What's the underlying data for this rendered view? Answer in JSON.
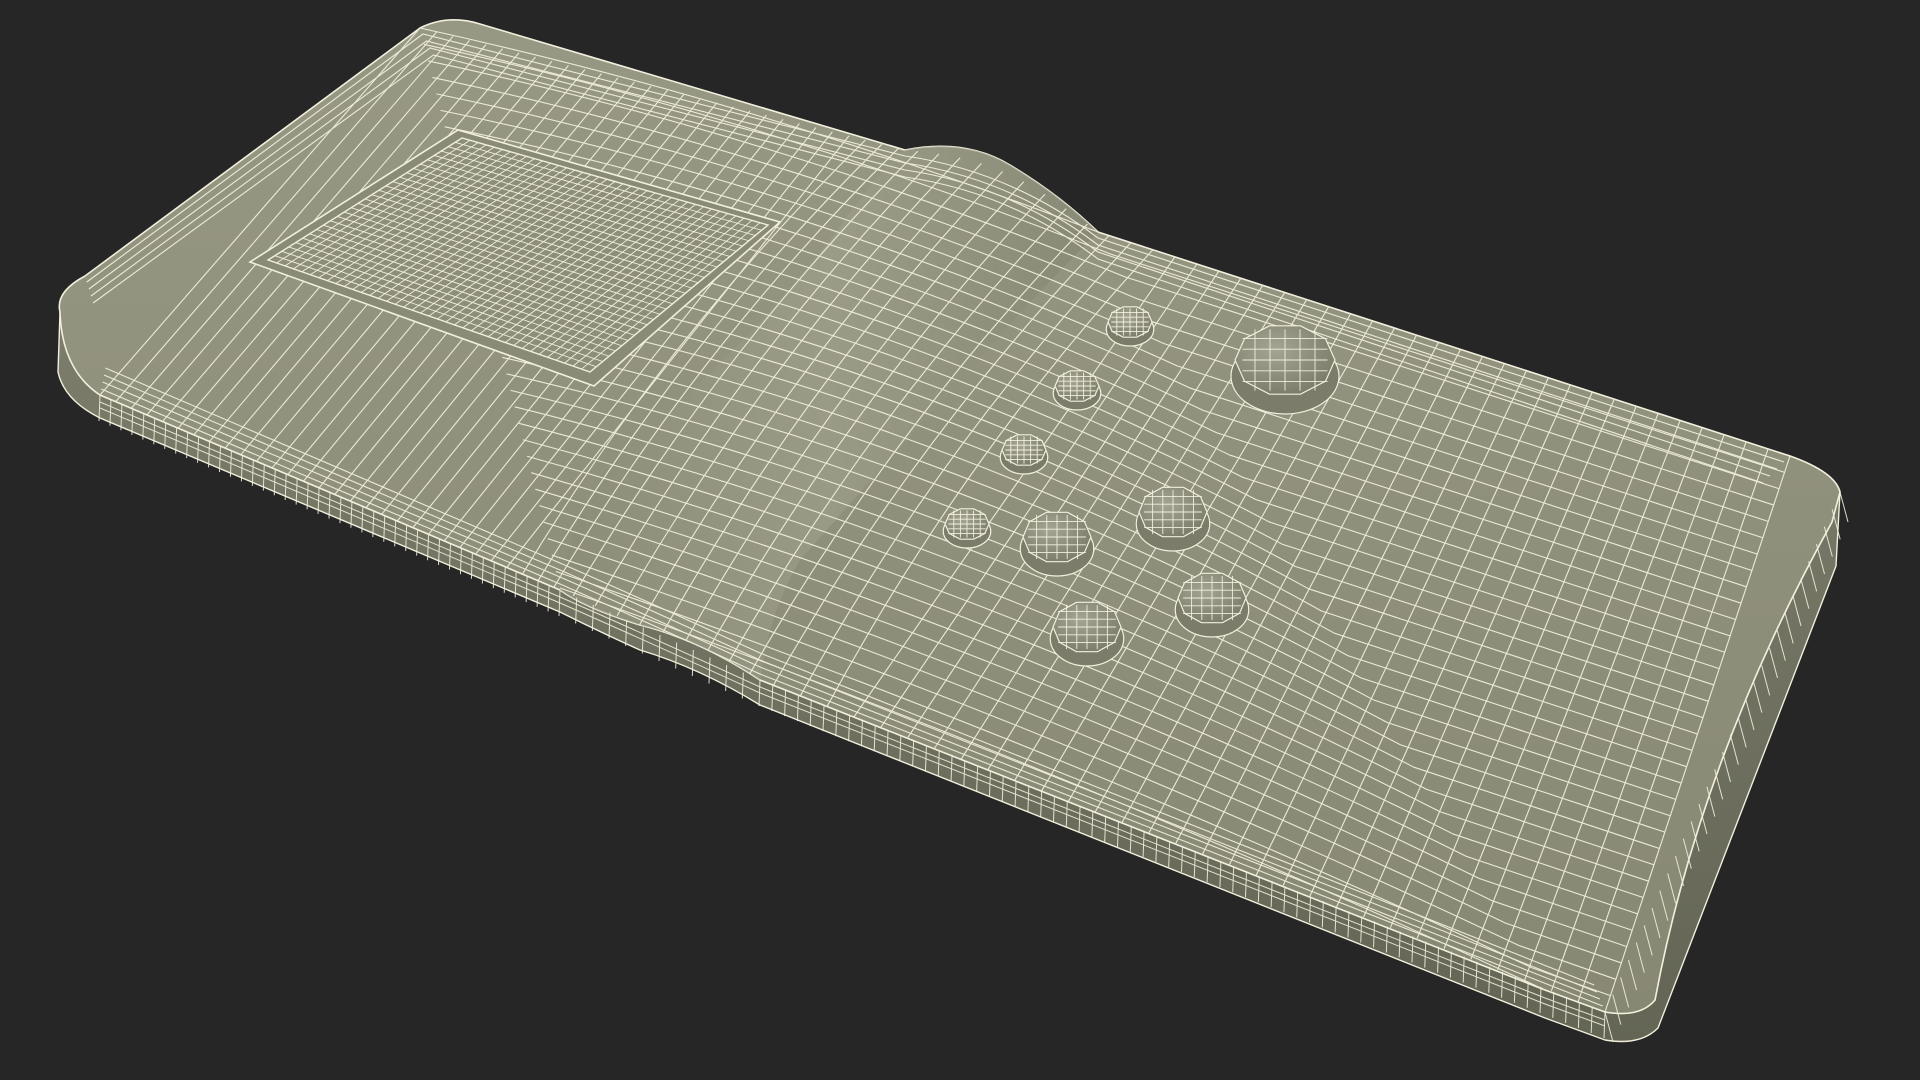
{
  "scene": {
    "subject": "wireframe-handheld-device-model",
    "background_color": "#262626",
    "surface_color": "#8f907c",
    "surface_shadow_color": "#6f705f",
    "surface_highlight_color": "#a3a491",
    "wire_color": "#f2efdc",
    "icons": [
      "display-screen-icon",
      "round-button-icon"
    ]
  }
}
